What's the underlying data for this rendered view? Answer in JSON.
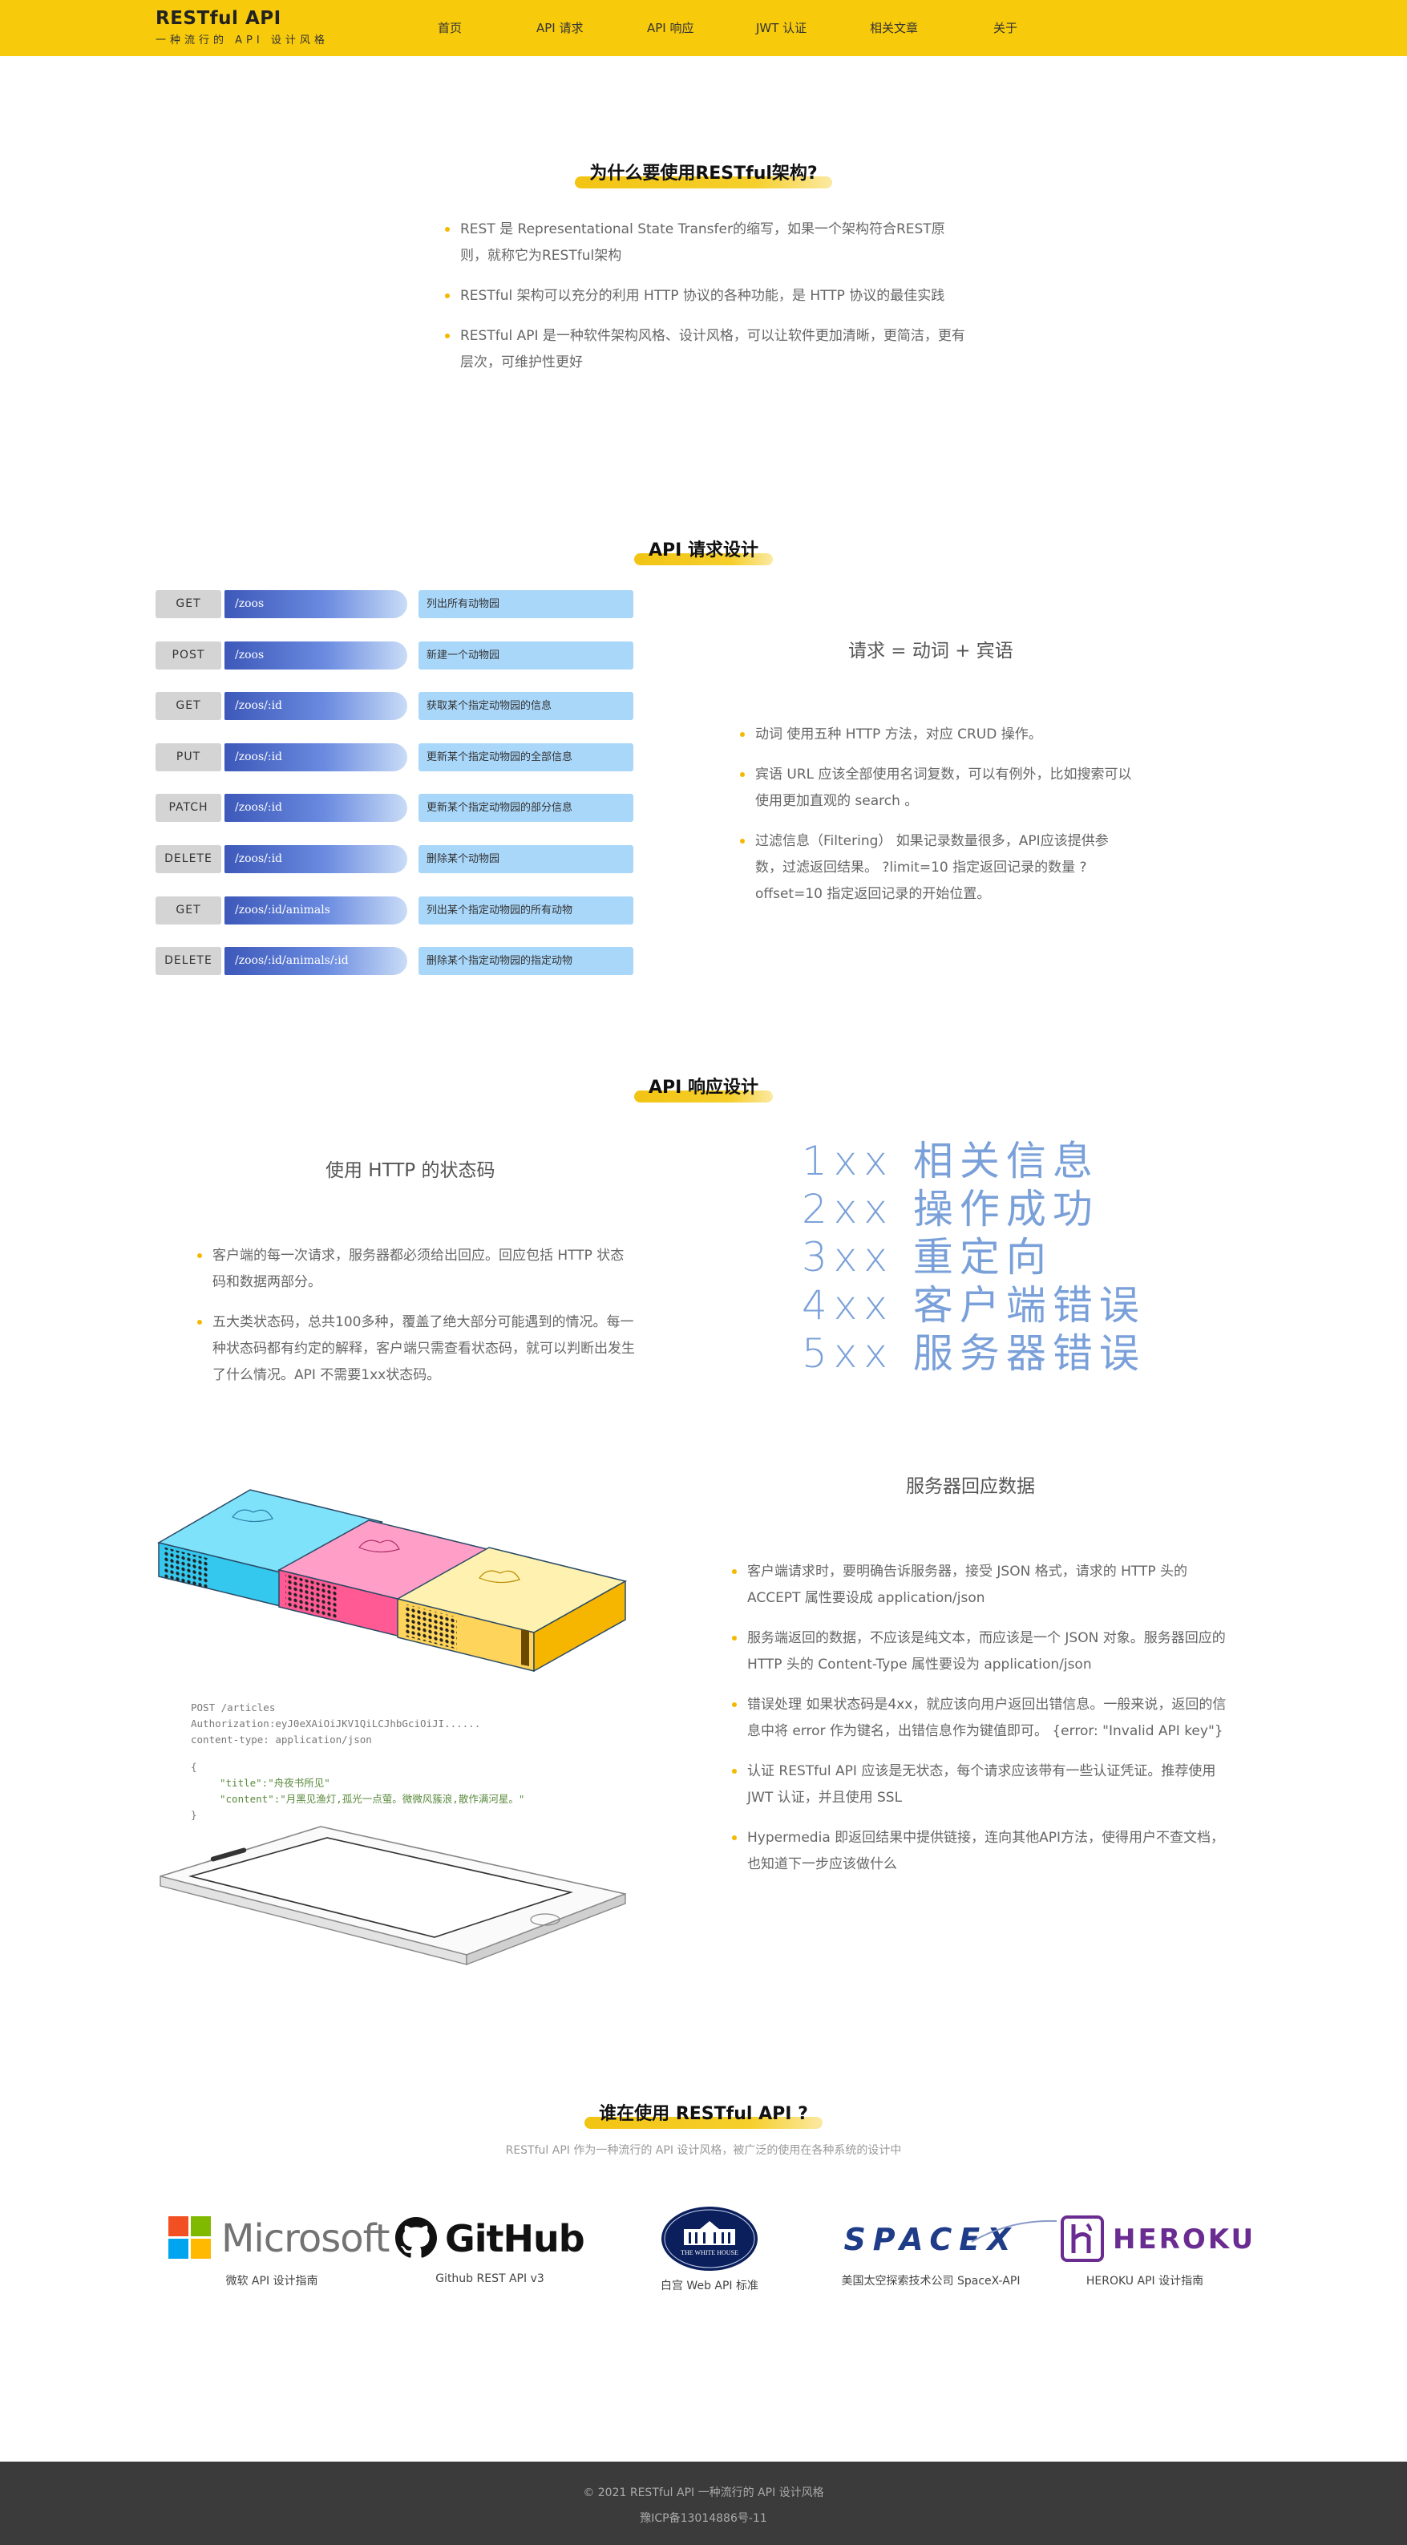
{
  "header": {
    "brand_title": "RESTful API",
    "brand_subtitle": "一种流行的 API 设计风格",
    "nav": [
      "首页",
      "API 请求",
      "API 响应",
      "JWT 认证",
      "相关文章",
      "关于"
    ]
  },
  "why": {
    "title": "为什么要使用RESTful架构?",
    "points": [
      "REST 是 Representational State Transfer的缩写，如果一个架构符合REST原则，就称它为RESTful架构",
      "RESTful 架构可以充分的利用 HTTP 协议的各种功能，是 HTTP 协议的最佳实践",
      "RESTful API 是一种软件架构风格、设计风格，可以让软件更加清晰，更简洁，更有层次，可维护性更好"
    ]
  },
  "request": {
    "title": "API 请求设计",
    "rows": [
      {
        "method": "GET",
        "path": "/zoos",
        "desc": "列出所有动物园"
      },
      {
        "method": "POST",
        "path": "/zoos",
        "desc": "新建一个动物园"
      },
      {
        "method": "GET",
        "path": "/zoos/:id",
        "desc": "获取某个指定动物园的信息"
      },
      {
        "method": "PUT",
        "path": "/zoos/:id",
        "desc": "更新某个指定动物园的全部信息"
      },
      {
        "method": "PATCH",
        "path": "/zoos/:id",
        "desc": "更新某个指定动物园的部分信息"
      },
      {
        "method": "DELETE",
        "path": "/zoos/:id",
        "desc": "删除某个动物园"
      },
      {
        "method": "GET",
        "path": "/zoos/:id/animals",
        "desc": "列出某个指定动物园的所有动物"
      },
      {
        "method": "DELETE",
        "path": "/zoos/:id/animals/:id",
        "desc": "删除某个指定动物园的指定动物"
      }
    ],
    "formula": "请求 = 动词 + 宾语",
    "points": [
      "动词 使用五种 HTTP 方法，对应 CRUD 操作。",
      "宾语 URL 应该全部使用名词复数，可以有例外，比如搜索可以使用更加直观的 search 。",
      "过滤信息（Filtering） 如果记录数量很多，API应该提供参数，过滤返回结果。 ?limit=10 指定返回记录的数量 ?offset=10 指定返回记录的开始位置。"
    ]
  },
  "response": {
    "title": "API 响应设计",
    "status_heading": "使用 HTTP 的状态码",
    "status_points": [
      "客户端的每一次请求，服务器都必须给出回应。回应包括 HTTP 状态码和数据两部分。",
      "五大类状态码，总共100多种，覆盖了绝大部分可能遇到的情况。每一种状态码都有约定的解释，客户端只需查看状态码，就可以判断出发生了什么情况。API 不需要1xx状态码。"
    ],
    "status_codes": [
      "1xx 相关信息",
      "2xx 操作成功",
      "3xx 重定向",
      "4xx 客户端错误",
      "5xx 服务器错误"
    ],
    "data_heading": "服务器回应数据",
    "data_points": [
      "客户端请求时，要明确告诉服务器，接受 JSON 格式，请求的 HTTP 头的 ACCEPT 属性要设成 application/json",
      "服务端返回的数据，不应该是纯文本，而应该是一个 JSON 对象。服务器回应的 HTTP 头的 Content-Type 属性要设为 application/json",
      "错误处理 如果状态码是4xx，就应该向用户返回出错信息。一般来说，返回的信息中将 error 作为键名，出错信息作为键值即可。 {error: \"Invalid API key\"}",
      "认证 RESTful API 应该是无状态，每个请求应该带有一些认证凭证。推荐使用 JWT 认证，并且使用 SSL",
      "Hypermedia 即返回结果中提供链接，连向其他API方法，使得用户不查文档，也知道下一步应该做什么"
    ],
    "code": {
      "line1": "POST /articles",
      "line2": "Authorization:eyJ0eXAiOiJKV1QiLCJhbGciOiJI......",
      "line3": "content-type: application/json",
      "open": "{",
      "title_line": "\"title\":\"舟夜书所见\"",
      "content_line": "\"content\":\"月黑见渔灯,孤光一点萤。微微风簇浪,散作满河星。\"",
      "close": "}"
    }
  },
  "users": {
    "title": "谁在使用 RESTful API ?",
    "subtitle": "RESTful API 作为一种流行的 API 设计风格，被广泛的使用在各种系统的设计中",
    "logos": [
      {
        "name": "Microsoft",
        "caption": "微软 API 设计指南",
        "icon": "microsoft-logo"
      },
      {
        "name": "GitHub",
        "caption": "Github REST API v3",
        "icon": "github-logo"
      },
      {
        "name": "THE WHITE HOUSE",
        "caption": "白宫 Web API 标准",
        "icon": "white-house-seal"
      },
      {
        "name": "SPACEX",
        "caption": "美国太空探索技术公司 SpaceX-API",
        "icon": "spacex-logo"
      },
      {
        "name": "HEROKU",
        "caption": "HEROKU API 设计指南",
        "icon": "heroku-logo"
      }
    ]
  },
  "footer": {
    "copyright": "© 2021 RESTful API  一种流行的 API 设计风格",
    "icp": "豫ICP备13014886号-11"
  },
  "colors": {
    "header": "#f7ca0c",
    "accent": "#f5b800",
    "path_blue": "#3d58b9",
    "desc_blue": "#a9d7fa",
    "status_blue": "#7aa0d9",
    "footer": "#3b3b3b"
  }
}
